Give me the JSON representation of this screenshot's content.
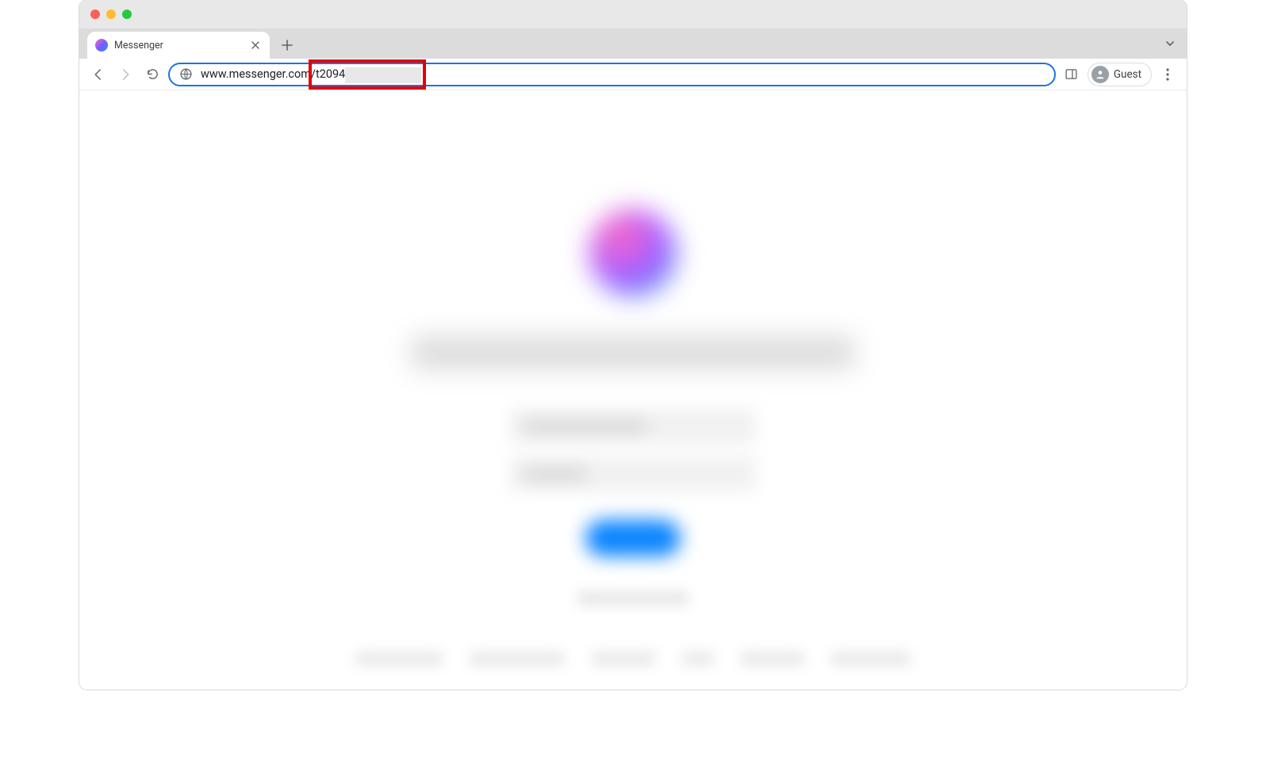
{
  "tab": {
    "title": "Messenger"
  },
  "url": {
    "domain": "www.messenger.com",
    "path_visible": "/t2094"
  },
  "profile": {
    "label": "Guest"
  },
  "annotation": {
    "description": "Red rectangle highlighting a portion of the URL path; remainder of the path is obscured by a grey redaction bar."
  },
  "page": {
    "note": "Page content (Messenger login screen) is heavily blurred and illegible in the screenshot; only the gradient Messenger logo, a blurred headline, two blurred input fields, a blurred blue button, a blurred small link, and a blurred footer row are discernible."
  },
  "footer_widths": [
    110,
    120,
    80,
    40,
    80,
    100
  ]
}
